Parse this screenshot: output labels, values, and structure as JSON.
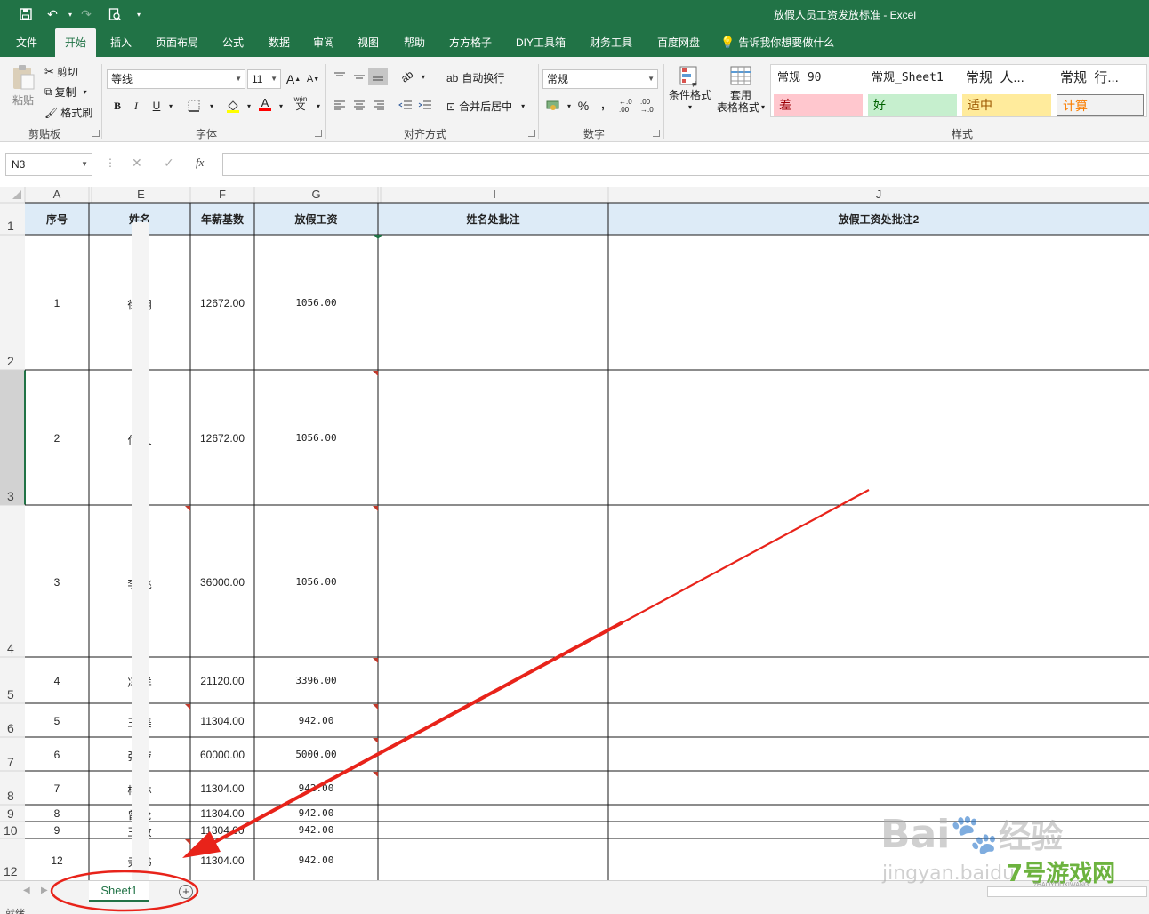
{
  "window": {
    "title": "放假人员工资发放标准 - Excel"
  },
  "ribbon_tabs": [
    "文件",
    "开始",
    "插入",
    "页面布局",
    "公式",
    "数据",
    "审阅",
    "视图",
    "帮助",
    "方方格子",
    "DIY工具箱",
    "财务工具",
    "百度网盘"
  ],
  "active_tab": "开始",
  "tell_me": "告诉我你想要做什么",
  "clipboard": {
    "paste": "粘贴",
    "cut": "剪切",
    "copy": "复制",
    "format_painter": "格式刷",
    "label": "剪贴板"
  },
  "font": {
    "name": "等线",
    "size": "11",
    "label": "字体",
    "bold": "B",
    "italic": "I",
    "underline": "U",
    "grow": "A",
    "shrink": "A",
    "color_a": "A",
    "wen": "wén",
    "wen_char": "文"
  },
  "alignment": {
    "wrap": "自动换行",
    "merge": "合并后居中",
    "label": "对齐方式"
  },
  "number": {
    "format": "常规",
    "label": "数字",
    "percent": "%",
    "comma": ",",
    "inc": "←.0 .00",
    "dec": ".00 →.0"
  },
  "styles": {
    "label": "样式",
    "conditional": "条件格式",
    "table_format_1": "套用",
    "table_format_2": "表格格式",
    "cells": [
      "常规 90",
      "常规_Sheet1",
      "常规_人...",
      "常规_行...",
      "差",
      "好",
      "适中",
      "计算"
    ]
  },
  "formula_bar": {
    "name_box": "N3",
    "cancel": "✕",
    "enter": "✓",
    "fx": "fx",
    "value": ""
  },
  "columns": [
    "A",
    "E",
    "F",
    "G",
    "I",
    "J"
  ],
  "header_row": {
    "row": "1",
    "cells": [
      "序号",
      "姓名",
      "年薪基数",
      "放假工资",
      "姓名处批注",
      "放假工资处批注2"
    ]
  },
  "rows": [
    {
      "row": "2",
      "no": "1",
      "name": "徐 明",
      "base": "12672.00",
      "pay": "1056.00"
    },
    {
      "row": "3",
      "no": "2",
      "name": "付 文",
      "base": "12672.00",
      "pay": "1056.00"
    },
    {
      "row": "4",
      "no": "3",
      "name": "李 姚",
      "base": "36000.00",
      "pay": "1056.00"
    },
    {
      "row": "5",
      "no": "4",
      "name": "冯 洋",
      "base": "21120.00",
      "pay": "3396.00"
    },
    {
      "row": "6",
      "no": "5",
      "name": "王 美",
      "base": "11304.00",
      "pay": "942.00"
    },
    {
      "row": "7",
      "no": "6",
      "name": "张 萍",
      "base": "60000.00",
      "pay": "5000.00"
    },
    {
      "row": "8",
      "no": "7",
      "name": "杨 林",
      "base": "11304.00",
      "pay": "942.00"
    },
    {
      "row": "9",
      "no": "8",
      "name": "曾 伦",
      "base": "11304.00",
      "pay": "942.00"
    },
    {
      "row": "10",
      "no": "9",
      "name": "王 敏",
      "base": "11304.00",
      "pay": "942.00"
    },
    {
      "row": "12",
      "no": "12",
      "name": "尹 书",
      "base": "11304.00",
      "pay": "942.00"
    }
  ],
  "sheet_tabs": [
    "Sheet1"
  ],
  "add_sheet": "+",
  "status": "就绪",
  "watermark": {
    "baidu": "Bai",
    "baidu_cn": "经验",
    "url": "jingyan.baidu",
    "brand": "7号游戏网",
    "brand_en": "7HAOYOUXIWANG"
  },
  "colors": {
    "accent": "#217346",
    "header_fill": "#ddebf7",
    "annotation": "#e8231a"
  }
}
